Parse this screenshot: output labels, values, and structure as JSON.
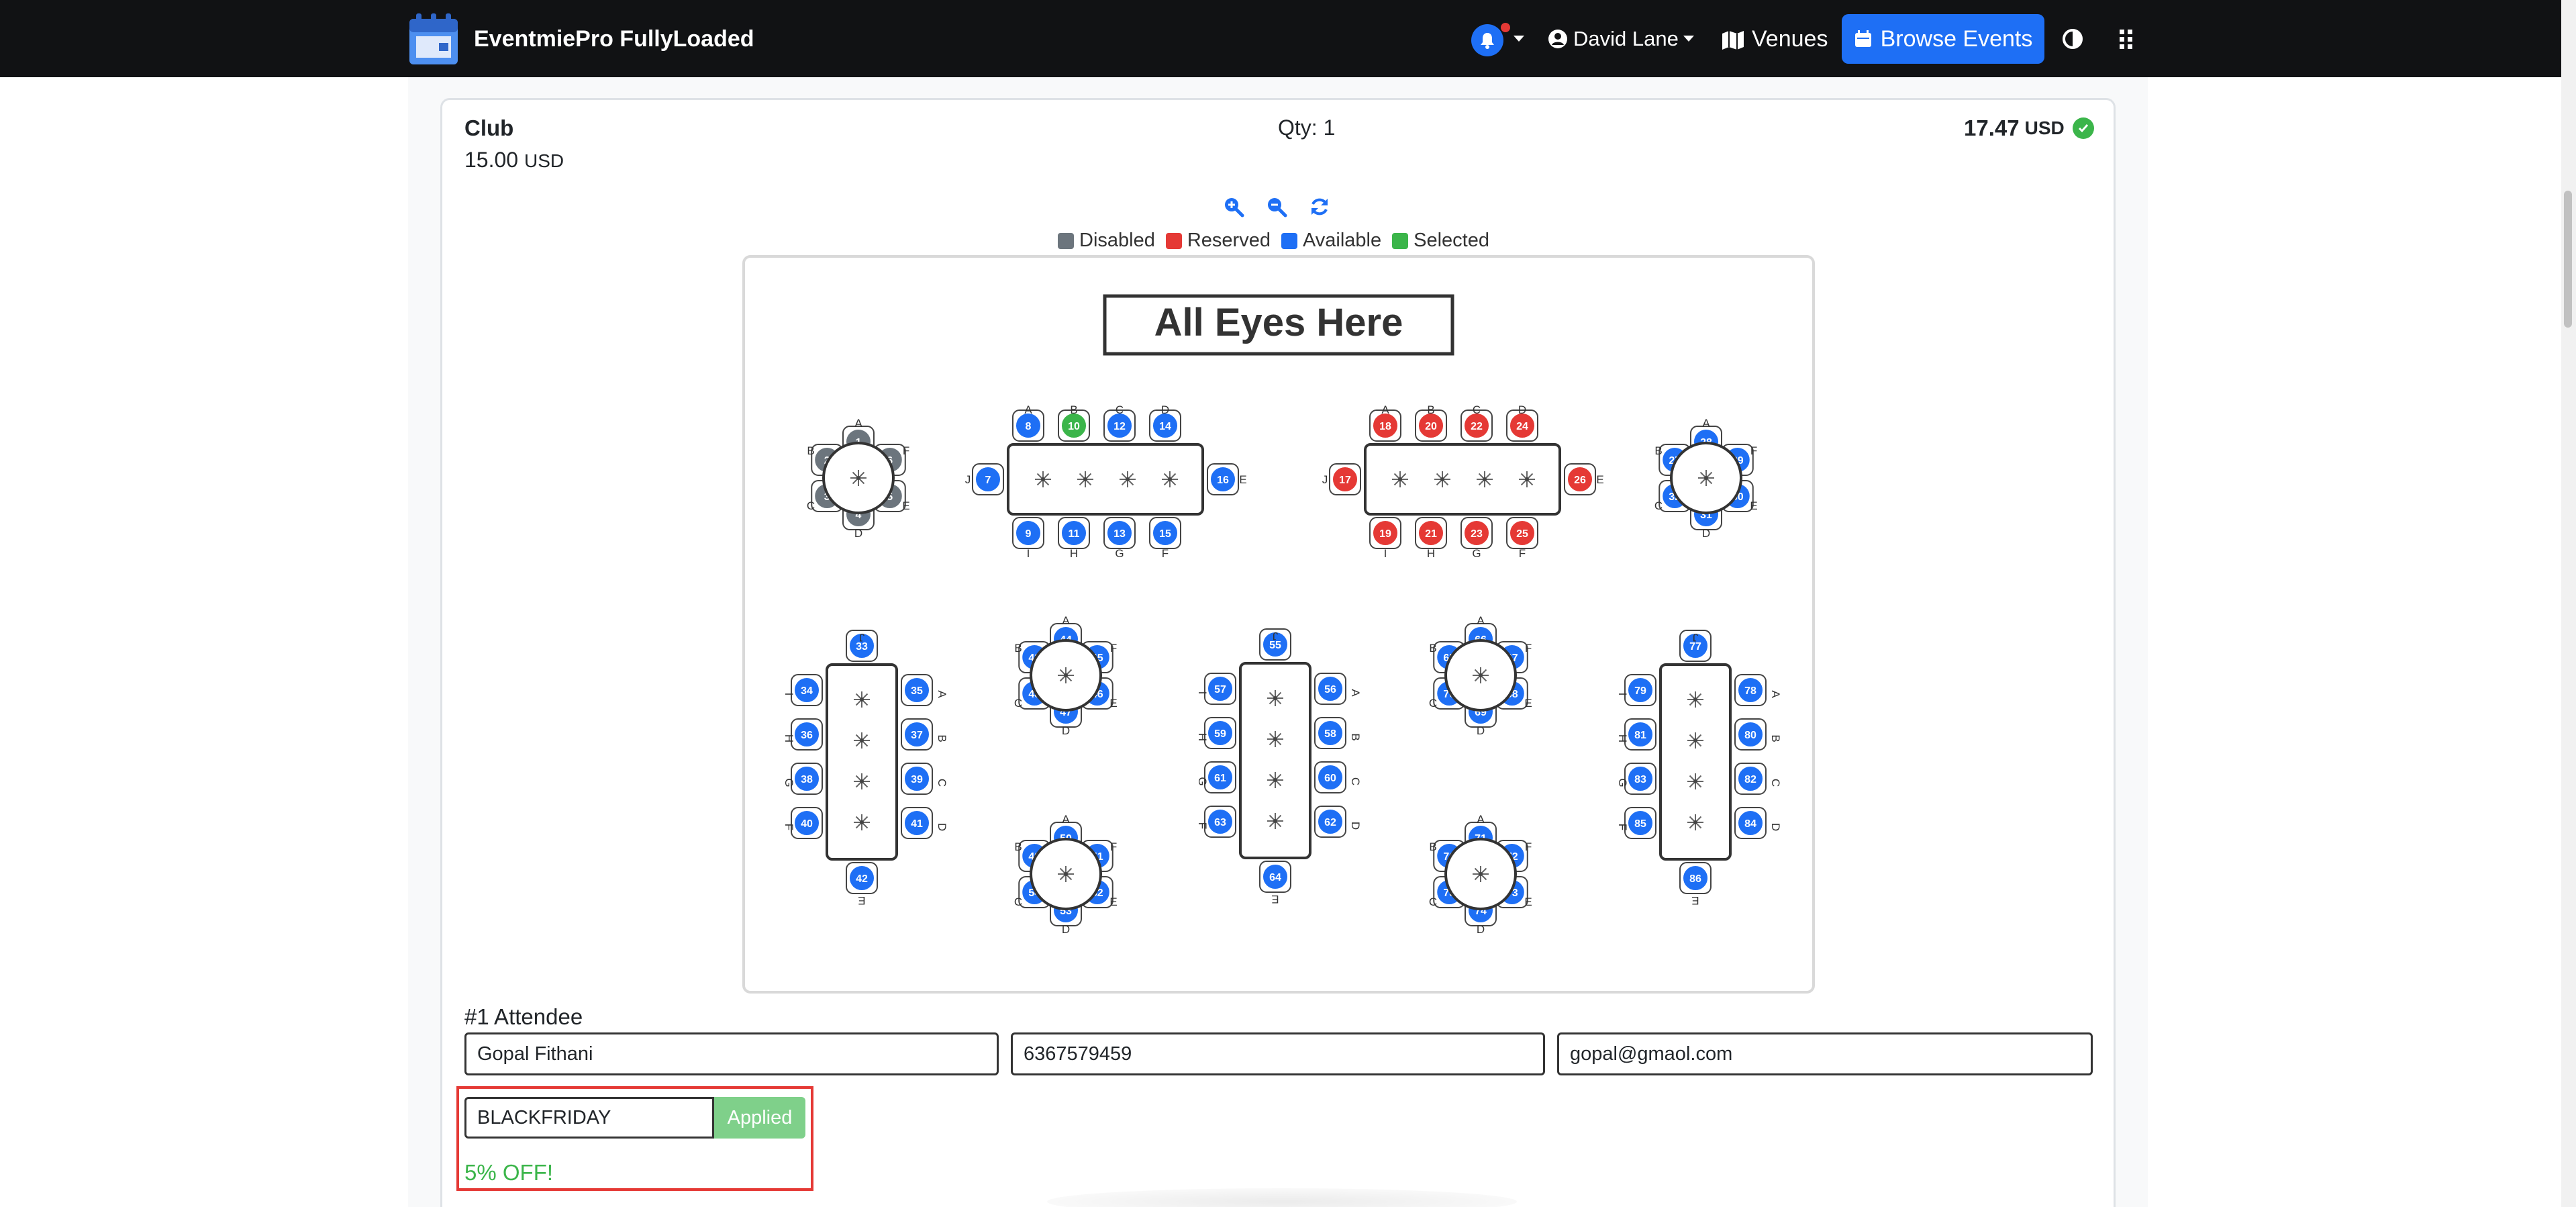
{
  "navbar": {
    "brand": "EventmiePro FullyLoaded",
    "user": "David Lane",
    "venues": "Venues",
    "browse_events": "Browse Events",
    "accent": "#1e6ff5"
  },
  "ticket": {
    "name": "Club",
    "price": "15.00",
    "price_currency": "USD",
    "qty": "Qty: 1",
    "total": "17.47",
    "total_currency": "USD"
  },
  "legend": [
    {
      "label": "Disabled",
      "color": "#6c757d"
    },
    {
      "label": "Reserved",
      "color": "#e53935"
    },
    {
      "label": "Available",
      "color": "#1e6ff5"
    },
    {
      "label": "Selected",
      "color": "#3bb54a"
    }
  ],
  "seatmap": {
    "stage": "All Eyes Here",
    "disabled": [
      1,
      2,
      3,
      4,
      5,
      6
    ],
    "reserved": [
      17,
      18,
      19,
      20,
      21,
      22,
      23,
      24,
      25,
      26
    ],
    "selected": [
      10
    ]
  },
  "attendee": {
    "title": "#1 Attendee",
    "name": "Gopal Fithani",
    "phone": "6367579459",
    "email": "gopal@gmaol.com"
  },
  "promo": {
    "code": "BLACKFRIDAY",
    "button": "Applied",
    "message": "5% OFF!"
  }
}
